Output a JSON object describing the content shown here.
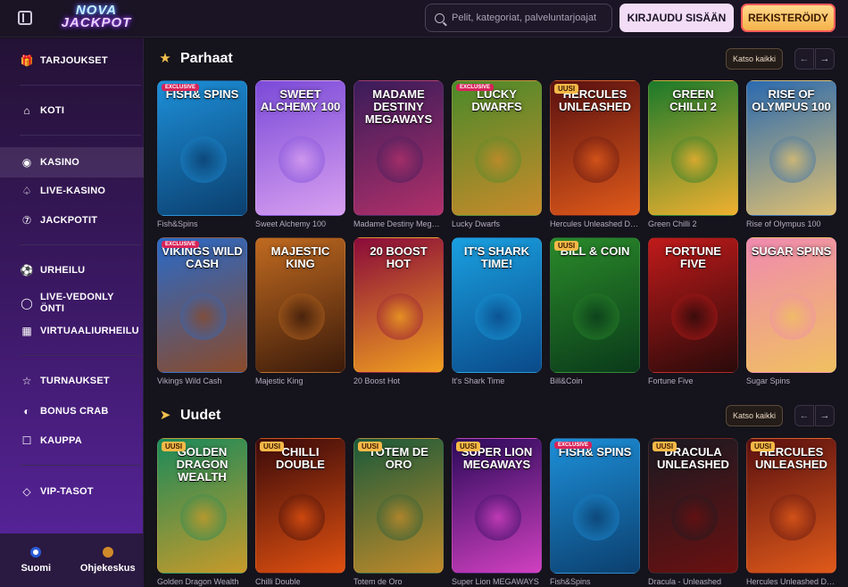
{
  "header": {
    "logo_line1": "NOVA",
    "logo_line2": "JACKPOT",
    "search_placeholder": "Pelit, kategoriat, palveluntarjoajat",
    "login_label": "KIRJAUDU SISÄÄN",
    "register_label": "REKISTERÖIDY"
  },
  "sidebar": {
    "items": [
      {
        "label": "TARJOUKSET",
        "icon": "gift-icon"
      },
      {
        "label": "KOTI",
        "icon": "home-icon"
      },
      {
        "label": "KASINO",
        "icon": "casino-chip-icon",
        "active": true
      },
      {
        "label": "LIVE-KASINO",
        "icon": "spade-icon"
      },
      {
        "label": "JACKPOTIT",
        "icon": "seven-icon"
      },
      {
        "label": "URHEILU",
        "icon": "ball-icon"
      },
      {
        "label": "LIVE-VEDONLYÖNTI",
        "icon": "live-icon"
      },
      {
        "label": "VIRTUAALIURHEILU",
        "icon": "gamepad-icon"
      },
      {
        "label": "TURNAUKSET",
        "icon": "trophy-icon"
      },
      {
        "label": "BONUS CRAB",
        "icon": "crab-icon"
      },
      {
        "label": "KAUPPA",
        "icon": "shop-icon"
      },
      {
        "label": "VIP-TASOT",
        "icon": "diamond-icon"
      }
    ],
    "bottom": {
      "language_label": "Suomi",
      "help_label": "Ohjekeskus"
    }
  },
  "sections": {
    "best": {
      "title": "Parhaat",
      "see_all": "Katso kaikki",
      "games": [
        {
          "name": "Fish&Spins",
          "title_art": "FISH& SPINS",
          "badge": "EXCLUSIVE",
          "c1": "#1d8fd8",
          "c2": "#0b3f6e"
        },
        {
          "name": "Sweet Alchemy 100",
          "title_art": "SWEET ALCHEMY 100",
          "badge": "",
          "c1": "#7a4ad8",
          "c2": "#d8a0f0"
        },
        {
          "name": "Madame Destiny Megaways",
          "title_art": "MADAME DESTINY MEGAWAYS",
          "badge": "",
          "c1": "#3a1c5a",
          "c2": "#b0306a"
        },
        {
          "name": "Lucky Dwarfs",
          "title_art": "LUCKY DWARFS",
          "badge": "EXCLUSIVE",
          "c1": "#4a8a2a",
          "c2": "#c88a2a"
        },
        {
          "name": "Hercules Unleashed Dream Drop",
          "title_art": "HERCULES UNLEASHED",
          "badge": "UUSI",
          "c1": "#5a1010",
          "c2": "#e05a1a"
        },
        {
          "name": "Green Chilli 2",
          "title_art": "GREEN CHILLI 2",
          "badge": "",
          "c1": "#1a7a2a",
          "c2": "#f0b030"
        },
        {
          "name": "Rise of Olympus 100",
          "title_art": "RISE OF OLYMPUS 100",
          "badge": "",
          "c1": "#2a6ab0",
          "c2": "#e0c070"
        }
      ],
      "games_row2": [
        {
          "name": "Vikings Wild Cash",
          "title_art": "VIKINGS WILD CASH",
          "badge": "EXCLUSIVE",
          "c1": "#2a6ac8",
          "c2": "#8a4a2a"
        },
        {
          "name": "Majestic King",
          "title_art": "MAJESTIC KING",
          "badge": "",
          "c1": "#c06a20",
          "c2": "#3a1a0a"
        },
        {
          "name": "20 Boost Hot",
          "title_art": "20 BOOST HOT",
          "badge": "",
          "c1": "#8a0a3a",
          "c2": "#f0a020"
        },
        {
          "name": "It's Shark Time",
          "title_art": "IT'S SHARK TIME!",
          "badge": "",
          "c1": "#1aa0e0",
          "c2": "#0a4a8a"
        },
        {
          "name": "Bill&Coin",
          "title_art": "BILL & COIN",
          "badge": "UUSI",
          "c1": "#2a8a2a",
          "c2": "#0a3a1a"
        },
        {
          "name": "Fortune Five",
          "title_art": "FORTUNE FIVE",
          "badge": "",
          "c1": "#c01a1a",
          "c2": "#2a0a0a"
        },
        {
          "name": "Sugar Spins",
          "title_art": "SUGAR SPINS",
          "badge": "",
          "c1": "#f08ab0",
          "c2": "#f0c060"
        }
      ]
    },
    "new": {
      "title": "Uudet",
      "see_all": "Katso kaikki",
      "games": [
        {
          "name": "Golden Dragon Wealth",
          "title_art": "GOLDEN DRAGON WEALTH",
          "badge": "UUSI",
          "c1": "#1a8a5a",
          "c2": "#c89a2a"
        },
        {
          "name": "Chilli Double",
          "title_art": "CHILLI DOUBLE",
          "badge": "UUSI",
          "c1": "#3a0a0a",
          "c2": "#e05010"
        },
        {
          "name": "Totem de Oro",
          "title_art": "TOTEM DE ORO",
          "badge": "UUSI",
          "c1": "#1a5a3a",
          "c2": "#c08a2a"
        },
        {
          "name": "Super Lion MEGAWAYS",
          "title_art": "SUPER LION MEGAWAYS",
          "badge": "UUSI",
          "c1": "#2a0a5a",
          "c2": "#d040c0"
        },
        {
          "name": "Fish&Spins",
          "title_art": "FISH& SPINS",
          "badge": "EXCLUSIVE",
          "c1": "#1d8fd8",
          "c2": "#0b3f6e"
        },
        {
          "name": "Dracula - Unleashed",
          "title_art": "DRACULA UNLEASHED",
          "badge": "UUSI",
          "c1": "#1a1a22",
          "c2": "#6a1010"
        },
        {
          "name": "Hercules Unleashed Dream Drop",
          "title_art": "HERCULES UNLEASHED",
          "badge": "UUSI",
          "c1": "#5a1010",
          "c2": "#e05a1a"
        }
      ]
    }
  }
}
